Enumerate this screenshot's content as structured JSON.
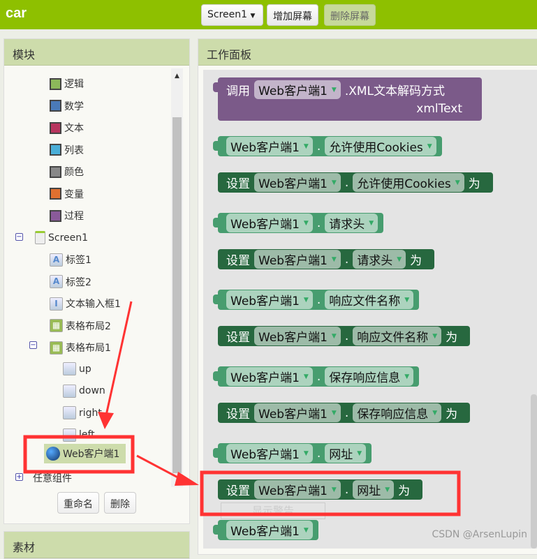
{
  "app_title": "car",
  "toolbar": {
    "screen_select": "Screen1",
    "add_screen": "增加屏幕",
    "remove_screen": "删除屏幕"
  },
  "blocks_panel": {
    "title": "模块",
    "builtin": [
      {
        "label": "逻辑",
        "color": "#8cb85a"
      },
      {
        "label": "数学",
        "color": "#4a7ab8"
      },
      {
        "label": "文本",
        "color": "#b8365f"
      },
      {
        "label": "列表",
        "color": "#4aaed8"
      },
      {
        "label": "颜色",
        "color": "#888888"
      },
      {
        "label": "变量",
        "color": "#e07030"
      },
      {
        "label": "过程",
        "color": "#8a5a9a"
      }
    ],
    "screen": "Screen1",
    "components": [
      "标签1",
      "标签2",
      "文本输入框1",
      "表格布局2",
      "表格布局1"
    ],
    "buttons": [
      "up",
      "down",
      "right",
      "left"
    ],
    "selected": "Web客户端1",
    "any_component": "任意组件",
    "rename": "重命名",
    "delete": "删除"
  },
  "media_panel": {
    "title": "素材"
  },
  "workspace": {
    "title": "工作面板",
    "call": {
      "prefix": "调用",
      "component": "Web客户端1",
      "method": ".XML文本解码方式",
      "param": "xmlText"
    },
    "set_word": "设置",
    "to_word": "为",
    "dot": ".",
    "component": "Web客户端1",
    "properties": [
      "允许使用Cookies",
      "请求头",
      "响应文件名称",
      "保存响应信息",
      "网址"
    ],
    "hidden_label": "显示警告"
  },
  "watermark": "CSDN @ArsenLupin",
  "colors": {
    "header": "#8ec000",
    "getter": "#479d6f",
    "setter": "#27683f",
    "procedure": "#7b5a89",
    "highlight": "#ff3333"
  }
}
